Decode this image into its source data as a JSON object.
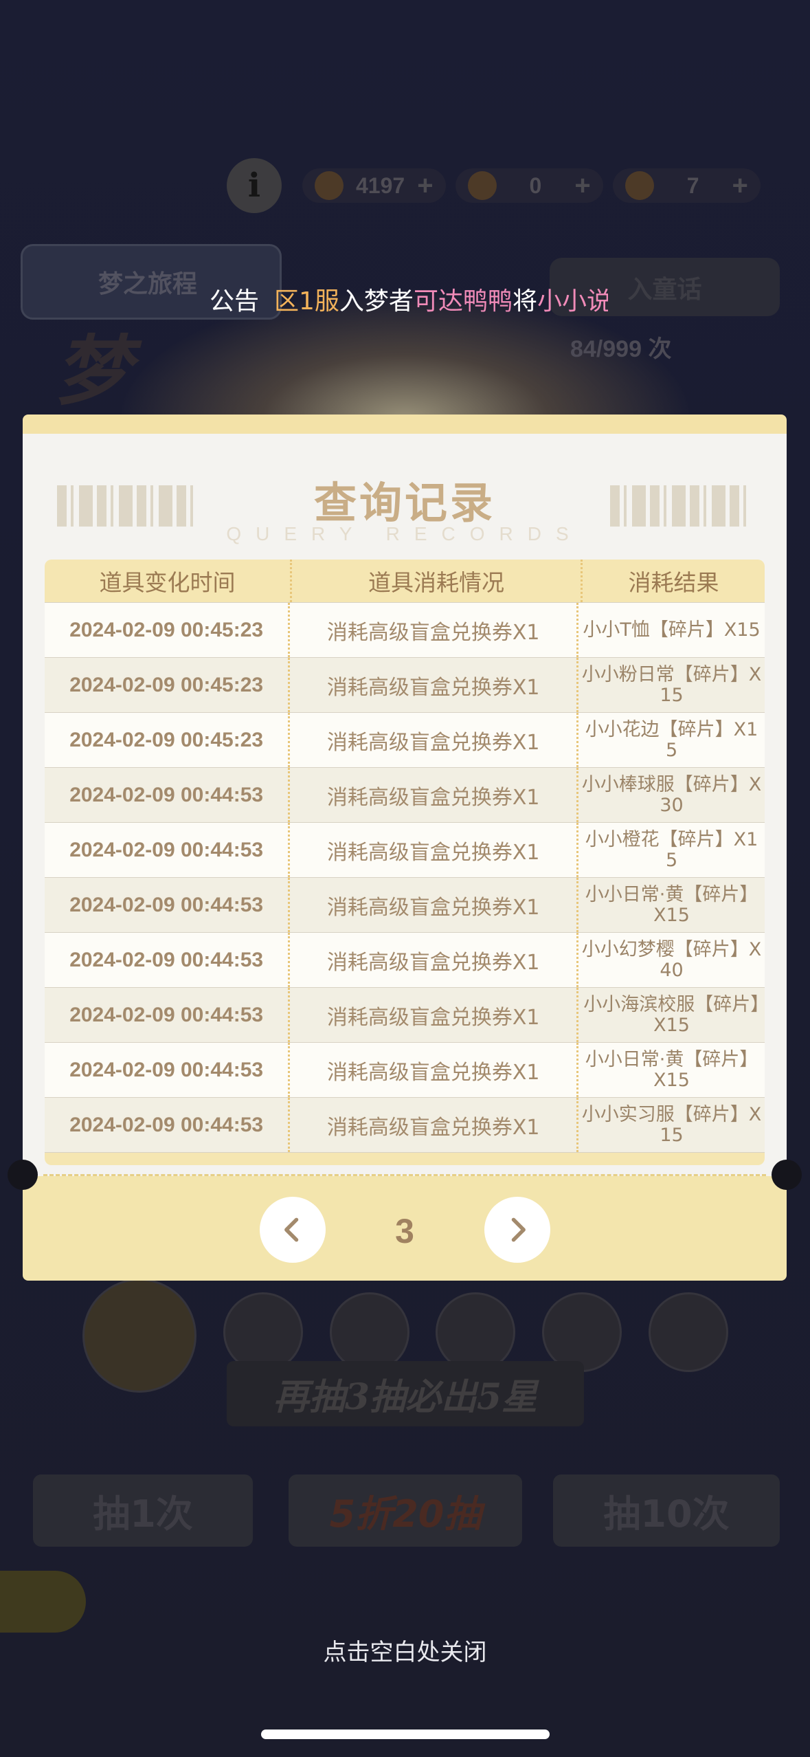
{
  "background": {
    "currency_1": "4197",
    "currency_2": "0",
    "currency_3": "7",
    "pool_tab_label": "梦之旅程",
    "pool_tab2_label": "入童话",
    "banner_title": "梦",
    "draw_count": "84/999 次",
    "pity_text": "再抽3抽必出5星",
    "draw_once_label": "抽1次",
    "discount_label": "5折20抽",
    "draw_ten_label": "抽10次"
  },
  "announcement": {
    "label": "公告",
    "segments": [
      {
        "text": "区1服",
        "color": "orange"
      },
      {
        "text": "入梦者",
        "color": "white"
      },
      {
        "text": "可达鸭鸭",
        "color": "pink"
      },
      {
        "text": "将",
        "color": "white"
      },
      {
        "text": "小小说",
        "color": "pink"
      }
    ]
  },
  "modal": {
    "title": "查询记录",
    "subtitle": "QUERY RECORDS",
    "columns": [
      "道具变化时间",
      "道具消耗情况",
      "消耗结果"
    ],
    "rows": [
      {
        "time": "2024-02-09 00:45:23",
        "usage": "消耗高级盲盒兑换券X1",
        "result": "小小T恤【碎片】X15"
      },
      {
        "time": "2024-02-09 00:45:23",
        "usage": "消耗高级盲盒兑换券X1",
        "result": "小小粉日常【碎片】X15"
      },
      {
        "time": "2024-02-09 00:45:23",
        "usage": "消耗高级盲盒兑换券X1",
        "result": "小小花边【碎片】X15"
      },
      {
        "time": "2024-02-09 00:44:53",
        "usage": "消耗高级盲盒兑换券X1",
        "result": "小小棒球服【碎片】X30"
      },
      {
        "time": "2024-02-09 00:44:53",
        "usage": "消耗高级盲盒兑换券X1",
        "result": "小小橙花【碎片】X15"
      },
      {
        "time": "2024-02-09 00:44:53",
        "usage": "消耗高级盲盒兑换券X1",
        "result": "小小日常·黄【碎片】X15"
      },
      {
        "time": "2024-02-09 00:44:53",
        "usage": "消耗高级盲盒兑换券X1",
        "result": "小小幻梦樱【碎片】X40"
      },
      {
        "time": "2024-02-09 00:44:53",
        "usage": "消耗高级盲盒兑换券X1",
        "result": "小小海滨校服【碎片】X15"
      },
      {
        "time": "2024-02-09 00:44:53",
        "usage": "消耗高级盲盒兑换券X1",
        "result": "小小日常·黄【碎片】X15"
      },
      {
        "time": "2024-02-09 00:44:53",
        "usage": "消耗高级盲盒兑换券X1",
        "result": "小小实习服【碎片】X15"
      }
    ],
    "page": "3",
    "prev_icon": "chevron-left-icon",
    "next_icon": "chevron-right-icon"
  },
  "close_hint": "点击空白处关闭",
  "colors": {
    "header": "#f5e6b2",
    "text_brown": "#a38a6c",
    "title": "#c9ad86"
  }
}
